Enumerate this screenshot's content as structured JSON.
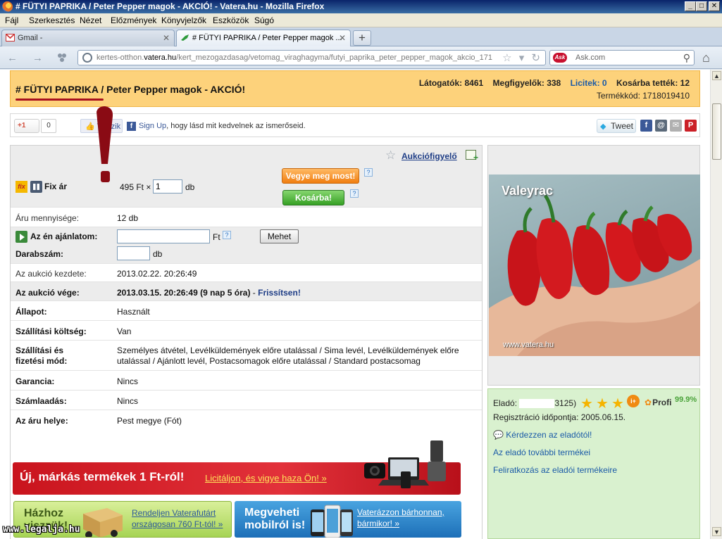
{
  "window": {
    "title": "# FÜTYI PAPRIKA / Peter Pepper magok - AKCIÓ! - Vatera.hu - Mozilla Firefox",
    "btn_min": "_",
    "btn_max": "□",
    "btn_close": "✕"
  },
  "menu": [
    "Fájl",
    "Szerkesztés",
    "Nézet",
    "Előzmények",
    "Könyvjelzők",
    "Eszközök",
    "Súgó"
  ],
  "tabs": [
    {
      "label": "Gmail -",
      "close": "✕"
    },
    {
      "label": "# FÜTYI PAPRIKA / Peter Pepper magok ...",
      "close": "✕"
    }
  ],
  "newtab_label": "+",
  "nav": {
    "back": "←",
    "forward": "→",
    "url_prefix": "kertes-otthon.",
    "url_host": "vatera.hu",
    "url_path": "/kert_mezogazdasag/vetomag_viraghagyma/futyi_paprika_peter_pepper_magok_akcio_171",
    "url_icons": "☆ ▾ ↻",
    "search_engine": "Ask",
    "search_placeholder": "Ask.com",
    "search_icon": "⚲",
    "home_icon": "⌂"
  },
  "header": {
    "title": "# FÜTYI PAPRIKA / Peter Pepper magok - AKCIÓ!",
    "visitors": "Látogatók: 8461",
    "watchers": "Megfigyelők: 338",
    "bids": "Licitek: 0",
    "basket": "Kosárba tették: 12",
    "product_code": "Termékkód: 1718019410"
  },
  "social": {
    "gplus": "+1",
    "gplus_count": "0",
    "fb_like": "Tetszik",
    "fb_signup_link": "Sign Up",
    "fb_signup_text": ", hogy lásd mit kedvelnek az ismerőseid.",
    "tweet": "Tweet",
    "share_icons": [
      "f",
      "@",
      "✉",
      "P"
    ]
  },
  "auction": {
    "watch_link": "Aukciófigyelő",
    "fix_badge": "fix",
    "fix_label": "Fix ár",
    "price": "495 Ft ×",
    "qty_value": "1",
    "qty_unit": "db",
    "buy_now": "Vegye meg most!",
    "to_basket": "Kosárba!",
    "help": "?",
    "rows": {
      "stock_label": "Áru mennyisége:",
      "stock_value": "12 db",
      "offer_label": "Az én ajánlatom:",
      "offer_unit": "Ft",
      "offer_button": "Mehet",
      "count_label": "Darabszám:",
      "count_unit": "db",
      "start_label": "Az aukció kezdete:",
      "start_value": "2013.02.22. 20:26:49",
      "end_label": "Az aukció vége:",
      "end_value": "2013.03.15. 20:26:49 (9 nap 5 óra)",
      "end_sep": " - ",
      "refresh": "Frissítsen!",
      "state_label": "Állapot:",
      "state_value": "Használt",
      "ship_cost_label": "Szállítási költség:",
      "ship_cost_value": "Van",
      "ship_mode_label": "Szállítási és fizetési mód:",
      "ship_mode_value": "Személyes átvétel, Levélküldemények előre utalással / Sima levél, Levélküldemények előre utalással / Ajánlott levél, Postacsomagok előre utalással / Standard postacsomag",
      "warranty_label": "Garancia:",
      "warranty_value": "Nincs",
      "invoice_label": "Számlaadás:",
      "invoice_value": "Nincs",
      "location_label": "Az áru helye:",
      "location_value": "Pest megye (Fót)"
    }
  },
  "banners": {
    "b1_title": "Új, márkás termékek 1 Ft-ról!",
    "b1_link": "Licitáljon, és vigye haza Ön! »",
    "b2_big": "Házhoz viszzük!",
    "b2_small": "Rendeljen Vaterafutárt országosan 760 Ft-tól! »",
    "b3_big": "Megveheti mobilról is!",
    "b3_small": "Vaterázzon bárhonnan, bármikor! »"
  },
  "image": {
    "watermark_top": "Valeyrac",
    "watermark_bottom": "www.vatera.hu"
  },
  "seller": {
    "label": "Eladó:",
    "score_suffix": "3125)",
    "rating_stars": 3,
    "plus_badge": "i+",
    "profi": "Profi",
    "percent": "99.9%",
    "registered": "Regisztráció időpontja: 2005.06.15.",
    "ask_link": "Kérdezzen az eladótól!",
    "more_link": "Az eladó további termékei",
    "subscribe_link": "Feliratkozás az eladói termékeire"
  },
  "watermark_site": "www.legalja.hu",
  "colors": {
    "header_bg": "#fdd27b",
    "link_blue": "#1a5aa7",
    "buy_orange": "#f07d10",
    "basket_green": "#36a024",
    "seller_bg": "#d9f1cf",
    "exclaim_red": "#8a0b14"
  }
}
